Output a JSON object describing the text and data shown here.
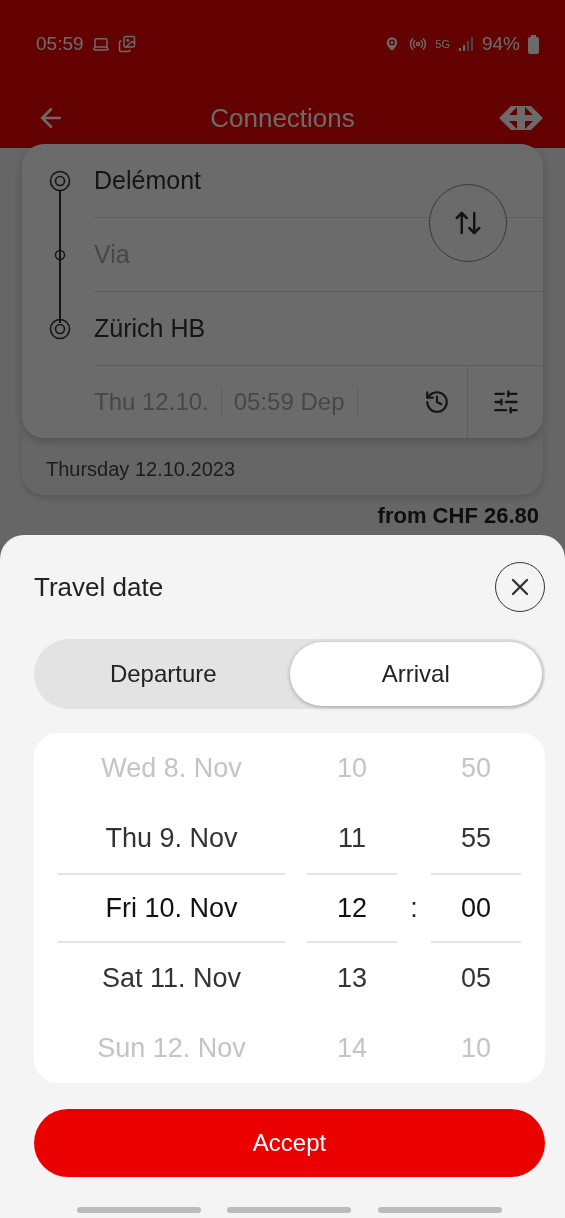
{
  "status_bar": {
    "time": "05:59",
    "network": "5G",
    "battery": "94%"
  },
  "header": {
    "title": "Connections"
  },
  "search": {
    "from": "Delémont",
    "via_placeholder": "Via",
    "to": "Zürich HB",
    "date": "Thu 12.10.",
    "time": "05:59 Dep"
  },
  "results": {
    "day": "Thursday 12.10.2023",
    "price": "from CHF 26.80"
  },
  "sheet": {
    "title": "Travel date",
    "modes": [
      {
        "label": "Departure",
        "selected": false
      },
      {
        "label": "Arrival",
        "selected": true
      }
    ],
    "days": [
      {
        "label": "Wed 8. Nov",
        "selected": false
      },
      {
        "label": "Thu 9. Nov",
        "selected": false
      },
      {
        "label": "Fri 10. Nov",
        "selected": true
      },
      {
        "label": "Sat 11. Nov",
        "selected": false
      },
      {
        "label": "Sun 12. Nov",
        "selected": false
      }
    ],
    "hours": [
      {
        "label": "10",
        "selected": false
      },
      {
        "label": "11",
        "selected": false
      },
      {
        "label": "12",
        "selected": true
      },
      {
        "label": "13",
        "selected": false
      },
      {
        "label": "14",
        "selected": false
      }
    ],
    "separator": ":",
    "minutes": [
      {
        "label": "50",
        "selected": false
      },
      {
        "label": "55",
        "selected": false
      },
      {
        "label": "00",
        "selected": true
      },
      {
        "label": "05",
        "selected": false
      },
      {
        "label": "10",
        "selected": false
      }
    ],
    "accept": "Accept"
  }
}
